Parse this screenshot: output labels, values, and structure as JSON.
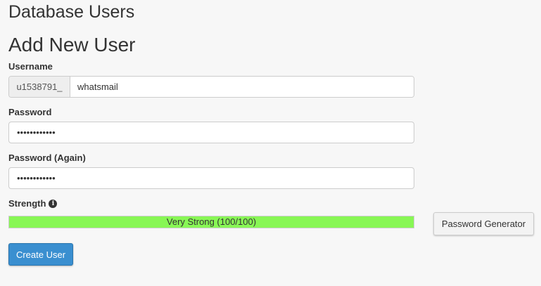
{
  "page_title": "Database Users",
  "section_title": "Add New User",
  "username": {
    "label": "Username",
    "prefix": "u1538791_",
    "value": "whatsmail"
  },
  "password": {
    "label": "Password",
    "value": "••••••••••••"
  },
  "password_again": {
    "label": "Password (Again)",
    "value": "••••••••••••"
  },
  "strength": {
    "label": "Strength",
    "text": "Very Strong (100/100)",
    "level": 1.0,
    "bar_color": "#88f755",
    "icon": "info-icon"
  },
  "buttons": {
    "password_generator": "Password Generator",
    "create_user": "Create User"
  },
  "colors": {
    "primary": "#3a8fd0"
  }
}
